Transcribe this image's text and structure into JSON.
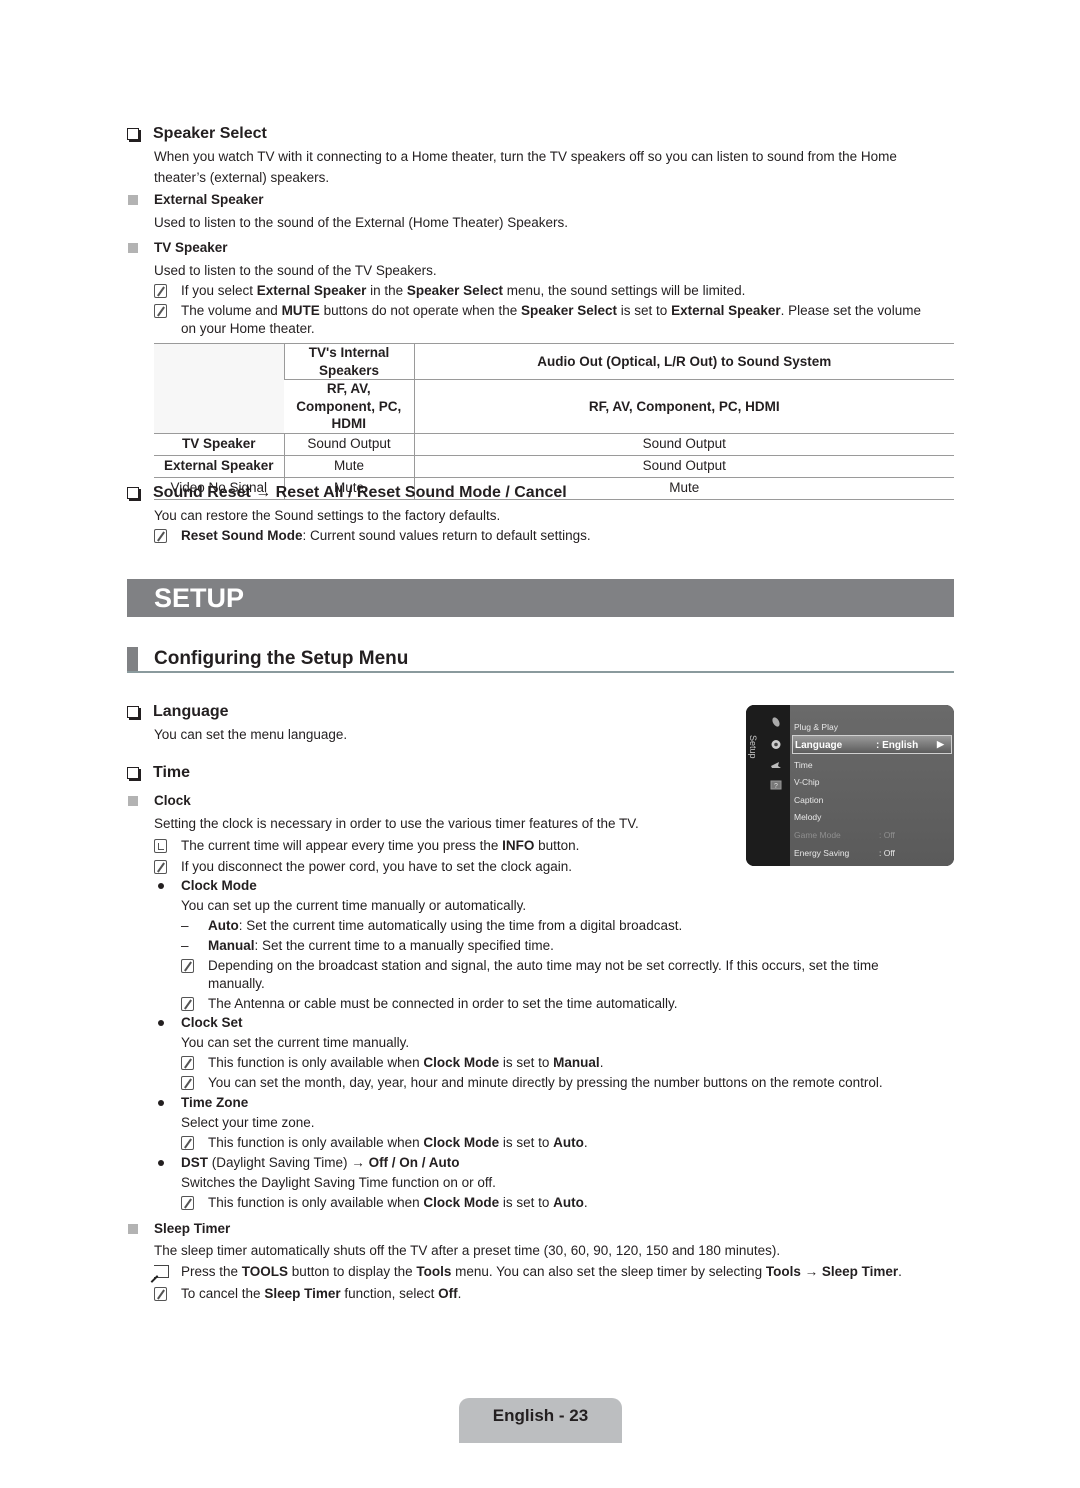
{
  "speaker_select": {
    "title": "Speaker Select",
    "intro_1": "When you watch TV with it connecting to a Home theater, turn the TV speakers off so you can listen to sound from the Home",
    "intro_2": "theater’s (external) speakers.",
    "external": {
      "title": "External Speaker",
      "desc": "Used to listen to the sound of the External (Home Theater) Speakers."
    },
    "tv": {
      "title": "TV Speaker",
      "desc": "Used to listen to the sound of the TV Speakers."
    },
    "note1": [
      "If you select ",
      "External Speaker",
      " in the ",
      "Speaker Select",
      " menu, the sound settings will be limited."
    ],
    "note2": [
      "The volume and ",
      "MUTE",
      " buttons do not operate when the ",
      "Speaker Select",
      " is set to ",
      "External Speaker",
      ". Please set the volume"
    ],
    "note2_line2": "on your Home theater.",
    "table": {
      "col_headers": [
        "TV's Internal Speakers",
        "Audio Out (Optical, L/R Out) to Sound System"
      ],
      "sub_headers": [
        "RF, AV, Component, PC, HDMI",
        "RF, AV, Component, PC, HDMI"
      ],
      "rows": [
        {
          "label": "TV Speaker",
          "internal": "Sound Output",
          "audio_out": "Sound Output"
        },
        {
          "label": "External Speaker",
          "internal": "Mute",
          "audio_out": "Sound Output"
        },
        {
          "label": "Video No Signal",
          "internal": "Mute",
          "audio_out": "Mute"
        }
      ]
    }
  },
  "sound_reset": {
    "title": "Sound Reset → Reset All / Reset Sound Mode / Cancel",
    "desc": "You can restore the Sound settings to the factory defaults.",
    "note": [
      "Reset Sound Mode",
      ": Current sound values return to default settings."
    ]
  },
  "setup_banner": "SETUP",
  "configuring_title": "Configuring the Setup Menu",
  "language": {
    "title": "Language",
    "desc": "You can set the menu language."
  },
  "tv_menu": {
    "side_label": "Setup",
    "items": [
      {
        "label": "Plug & Play",
        "value": ""
      },
      {
        "label": "Language",
        "value": ": English",
        "selected": true
      },
      {
        "label": "Time",
        "value": ""
      },
      {
        "label": "V-Chip",
        "value": ""
      },
      {
        "label": "Caption",
        "value": ""
      },
      {
        "label": "Melody",
        "value": ""
      },
      {
        "label": "Game Mode",
        "value": ": Off",
        "dim": true
      },
      {
        "label": "Energy Saving",
        "value": ": Off"
      }
    ],
    "arrow": "▶"
  },
  "time": {
    "title": "Time",
    "clock": {
      "title": "Clock",
      "desc": "Setting the clock is necessary in order to use the various timer features of the TV.",
      "note_info": [
        "The current time will appear every time you press the ",
        "INFO",
        " button."
      ],
      "note_power": "If you disconnect the power cord, you have to set the clock again.",
      "clock_mode": {
        "title": "Clock Mode",
        "desc": "You can set up the current time manually or automatically.",
        "auto": [
          "Auto",
          ": Set the current time automatically using the time from a digital broadcast."
        ],
        "manual": [
          "Manual",
          ": Set the current time to a manually specified time."
        ],
        "note1_line1": "Depending on the broadcast station and signal, the auto time may not be set correctly. If this occurs, set the time",
        "note1_line2": "manually.",
        "note2": "The Antenna or cable must be connected in order to set the time automatically."
      },
      "clock_set": {
        "title": "Clock Set",
        "desc": "You can set the current time manually.",
        "note1": [
          "This function is only available when ",
          "Clock Mode",
          " is set to ",
          "Manual",
          "."
        ],
        "note2": "You can set the month, day, year, hour and minute directly by pressing the number buttons on the remote control."
      },
      "time_zone": {
        "title": "Time Zone",
        "desc": "Select your time zone.",
        "note": [
          "This function is only available when ",
          "Clock Mode",
          " is set to ",
          "Auto",
          "."
        ]
      },
      "dst": {
        "title": [
          "DST",
          " (Daylight Saving Time) → ",
          "Off / On / Auto"
        ],
        "desc": "Switches the Daylight Saving Time function on or off.",
        "note": [
          "This function is only available when ",
          "Clock Mode",
          " is set to ",
          "Auto",
          "."
        ]
      }
    },
    "sleep_timer": {
      "title": "Sleep Timer",
      "desc": "The sleep timer automatically shuts off the TV after a preset time (30, 60, 90, 120, 150 and 180 minutes).",
      "tools_note": [
        "Press the ",
        "TOOLS",
        " button to display the ",
        "Tools",
        " menu. You can also set the sleep timer by selecting ",
        "Tools → Sleep Timer",
        "."
      ],
      "cancel_note": [
        "To cancel the ",
        "Sleep Timer",
        " function, select ",
        "Off",
        "."
      ]
    }
  },
  "footer": "English - 23"
}
